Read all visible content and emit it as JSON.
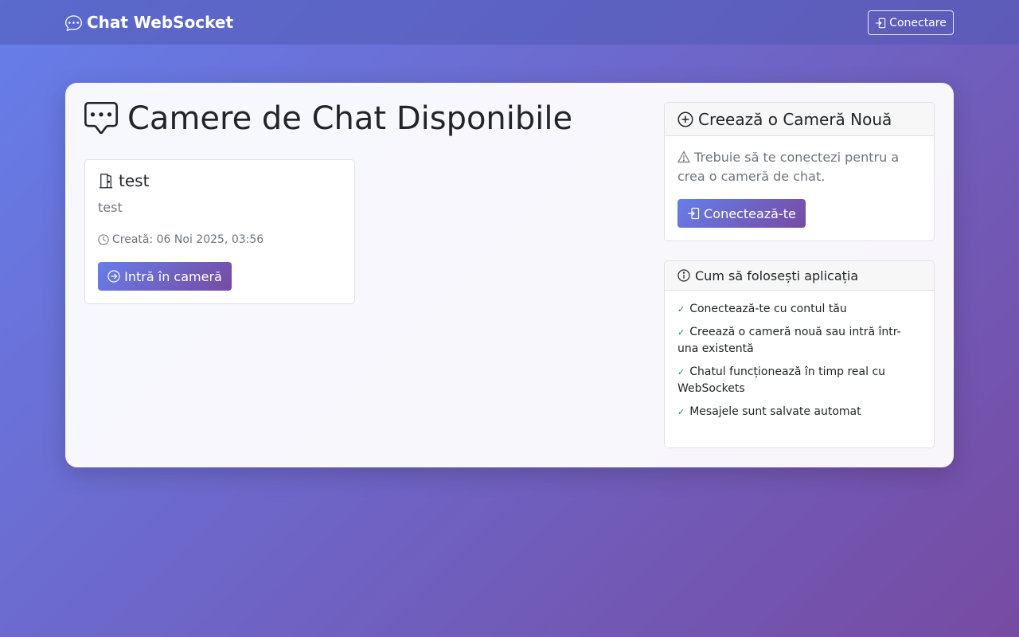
{
  "navbar": {
    "brand": "Chat WebSocket",
    "login_label": "Conectare"
  },
  "main": {
    "title": "Camere de Chat Disponibile",
    "rooms": [
      {
        "name": "test",
        "description": "test",
        "created": "Creată: 06 Noi 2025, 03:56",
        "join_label": "Intră în cameră"
      }
    ]
  },
  "create_room": {
    "title": "Creează o Cameră Nouă",
    "warning": "Trebuie să te conectezi pentru a crea o cameră de chat.",
    "connect_label": "Conectează-te"
  },
  "help": {
    "title": "Cum să folosești aplicația",
    "items": [
      "Conectează-te cu contul tău",
      "Creează o cameră nouă sau intră într-una existentă",
      "Chatul funcționează în timp real cu WebSockets",
      "Mesajele sunt salvate automat"
    ]
  },
  "colors": {
    "gradient_start": "#667eea",
    "gradient_end": "#764ba2",
    "check": "#198754"
  }
}
